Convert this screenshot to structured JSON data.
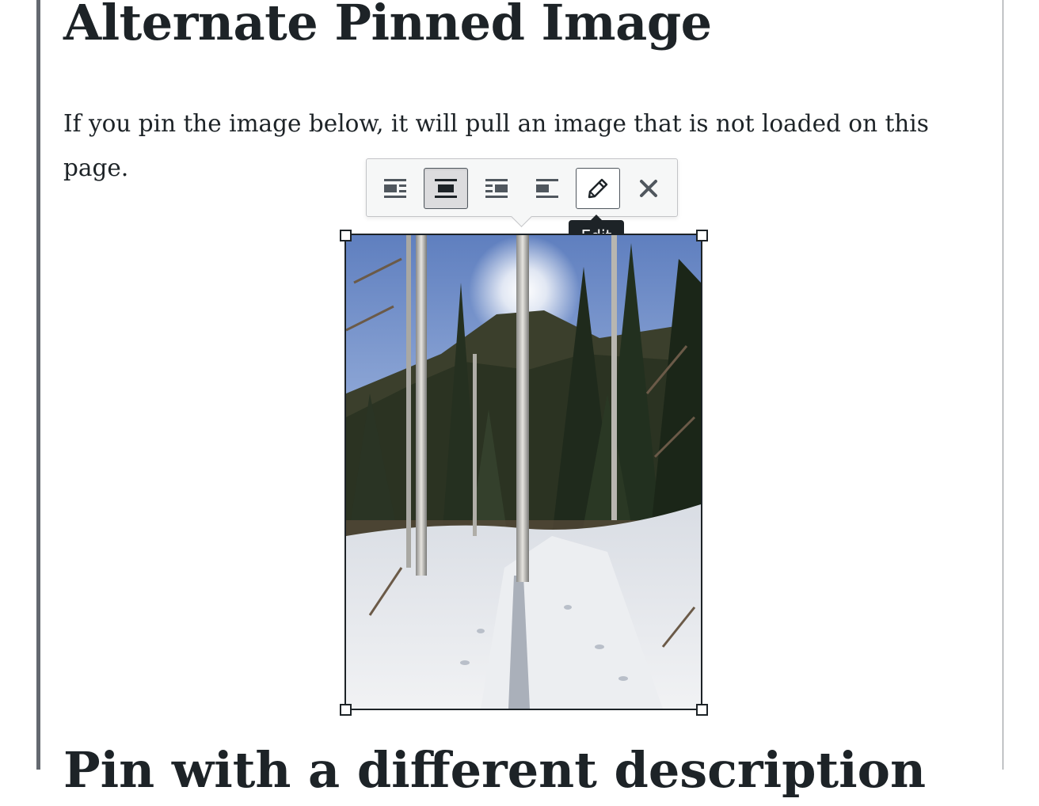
{
  "post": {
    "title": "Alternate Pinned Image",
    "paragraph": "If you pin the image below, it will pull an image that is not loaded on this page.",
    "next_heading": "Pin with a different description"
  },
  "image_toolbar": {
    "buttons": [
      {
        "name": "Align left",
        "icon": "align-left-icon",
        "state": "normal"
      },
      {
        "name": "Align center",
        "icon": "align-center-icon",
        "state": "active"
      },
      {
        "name": "Align right",
        "icon": "align-right-icon",
        "state": "normal"
      },
      {
        "name": "No alignment",
        "icon": "align-none-icon",
        "state": "normal"
      },
      {
        "name": "Edit",
        "icon": "pencil-icon",
        "state": "focused"
      },
      {
        "name": "Remove",
        "icon": "close-icon",
        "state": "normal"
      }
    ],
    "tooltip": "Edit"
  },
  "image": {
    "description": "Snowy trail through aspen and pine forest",
    "selected": true
  },
  "colors": {
    "text": "#1d2327",
    "left_rule": "#646970",
    "toolbar_bg": "#f6f7f7",
    "toolbar_border": "#c3c4c7",
    "tooltip_bg": "#1d2327"
  }
}
